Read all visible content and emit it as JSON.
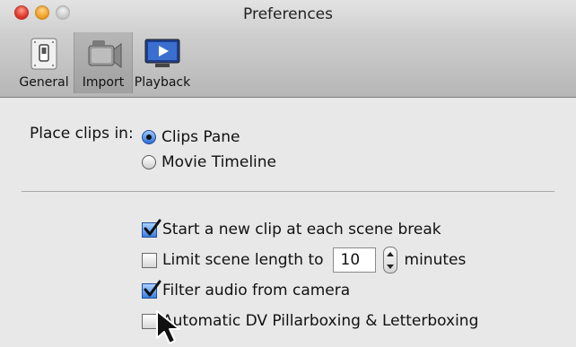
{
  "window": {
    "title": "Preferences"
  },
  "toolbar": {
    "tabs": [
      {
        "label": "General",
        "icon": "switch-icon",
        "selected": false
      },
      {
        "label": "Import",
        "icon": "video-camera-icon",
        "selected": true
      },
      {
        "label": "Playback",
        "icon": "screen-play-icon",
        "selected": false
      }
    ]
  },
  "import": {
    "place_clips_label": "Place clips in:",
    "place_clips_options": [
      {
        "label": "Clips Pane",
        "selected": true
      },
      {
        "label": "Movie Timeline",
        "selected": false
      }
    ],
    "checks": [
      {
        "label": "Start a new clip at each scene break",
        "checked": true
      },
      {
        "label": "Limit scene length to",
        "checked": false
      },
      {
        "label": "Filter audio from camera",
        "checked": true
      },
      {
        "label": "Automatic DV Pillarboxing & Letterboxing",
        "checked": false
      }
    ],
    "scene_length_value": "10",
    "scene_length_unit": "minutes"
  },
  "colors": {
    "accent": "#2c6fd6",
    "window_bg": "#e8e8e8"
  }
}
